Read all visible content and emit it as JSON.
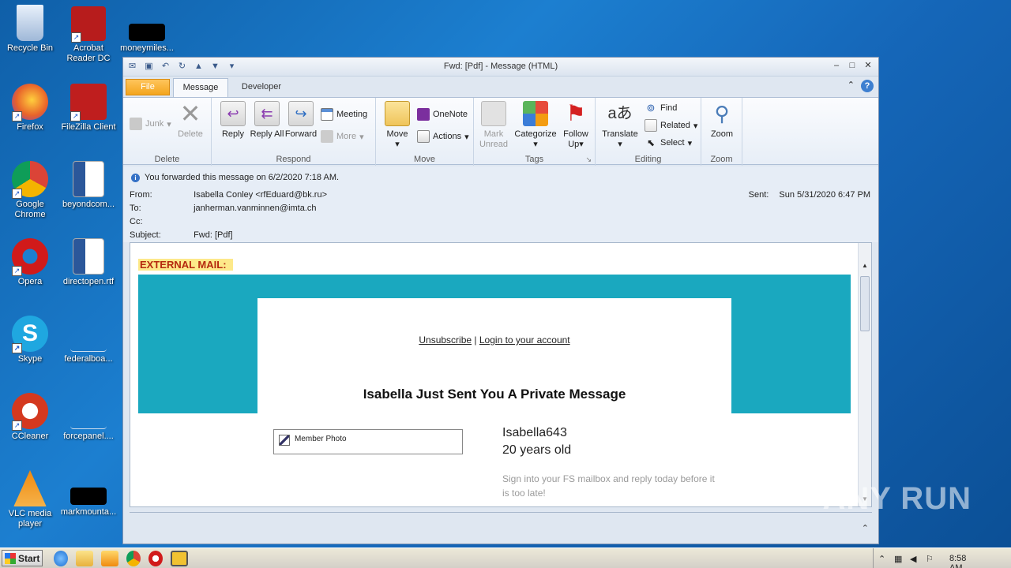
{
  "desktop": {
    "icons": [
      {
        "label": "Recycle Bin",
        "color": "#9fb8d8"
      },
      {
        "label": "Acrobat Reader DC",
        "color": "#b71c1c"
      },
      {
        "label": "moneymiles...",
        "color": "#000000"
      },
      {
        "label": "Firefox",
        "color": "#e8632a"
      },
      {
        "label": "FileZilla Client",
        "color": "#bf1e1e"
      },
      {
        "label": "Google Chrome",
        "color": "#2f8f3a"
      },
      {
        "label": "beyondcom...",
        "color": "#2b579a"
      },
      {
        "label": "Opera",
        "color": "#d11a1a"
      },
      {
        "label": "directopen.rtf",
        "color": "#2b579a"
      },
      {
        "label": "Skype",
        "color": "#1fa7e0"
      },
      {
        "label": "federalboa...",
        "color": "#1c7fd0"
      },
      {
        "label": "CCleaner",
        "color": "#d4391f"
      },
      {
        "label": "forcepanel....",
        "color": "#1c7fd0"
      },
      {
        "label": "VLC media player",
        "color": "#f08a0f"
      },
      {
        "label": "markmounta...",
        "color": "#000000"
      }
    ]
  },
  "window": {
    "title": "Fwd: [Pdf]    -  Message (HTML)",
    "tabs": {
      "file": "File",
      "message": "Message",
      "developer": "Developer"
    }
  },
  "ribbon": {
    "delete_group": {
      "junk": "Junk",
      "delete": "Delete",
      "label": "Delete"
    },
    "respond_group": {
      "reply": "Reply",
      "reply_all": "Reply All",
      "forward": "Forward",
      "meeting": "Meeting",
      "more": "More",
      "label": "Respond"
    },
    "move_group": {
      "move": "Move",
      "onenote": "OneNote",
      "actions": "Actions",
      "label": "Move"
    },
    "tags_group": {
      "mark_unread": "Mark Unread",
      "categorize": "Categorize",
      "follow_up": "Follow Up",
      "label": "Tags"
    },
    "editing_group": {
      "translate": "Translate",
      "find": "Find",
      "related": "Related",
      "select": "Select",
      "label": "Editing"
    },
    "zoom_group": {
      "zoom": "Zoom",
      "label": "Zoom"
    }
  },
  "header": {
    "info": "You forwarded this message on 6/2/2020 7:18 AM.",
    "from_label": "From:",
    "from_value": "Isabella Conley <rfEduard@bk.ru>",
    "to_label": "To:",
    "to_value": "janherman.vanminnen@imta.ch",
    "cc_label": "Cc:",
    "subject_label": "Subject:",
    "subject_value": "Fwd: [Pdf]",
    "sent_label": "Sent:",
    "sent_value": "Sun 5/31/2020 6:47 PM"
  },
  "body": {
    "external": "EXTERNAL MAIL:",
    "unsubscribe": "Unsubscribe",
    "separator": "|",
    "login": "Login to your account",
    "headline": "Isabella Just Sent You A Private Message",
    "photo_alt": "Member Photo",
    "username": "Isabella643",
    "age": "20 years old",
    "prompt": "Sign into your FS mailbox and reply today before it is too late!"
  },
  "taskbar": {
    "start": "Start",
    "clock": "8:58 AM"
  },
  "watermark": "ANY RUN"
}
